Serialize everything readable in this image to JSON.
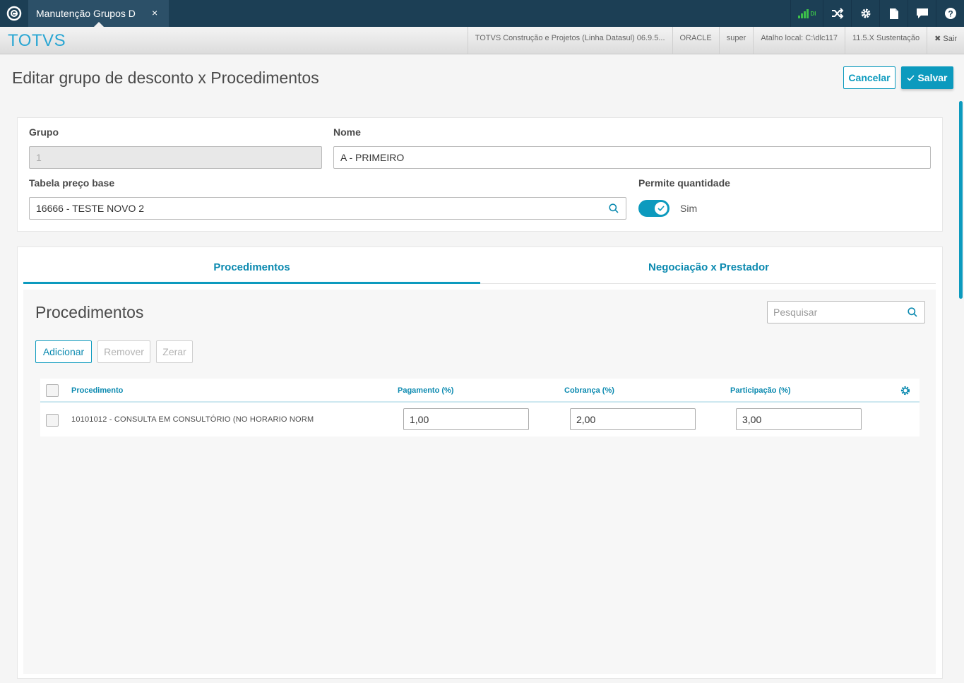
{
  "topbar": {
    "tab_title": "Manutenção Grupos D",
    "tab_close": "×",
    "signal_text": "DI"
  },
  "subbar": {
    "brand": "TOTVS",
    "items": [
      "TOTVS Construção e Projetos (Linha Datasul) 06.9.5...",
      "ORACLE",
      "super",
      "Atalho local: C:\\dlc117",
      "11.5.X Sustentação"
    ],
    "exit_label": "✖ Sair"
  },
  "page": {
    "title": "Editar grupo de desconto x Procedimentos",
    "cancel_label": "Cancelar",
    "save_label": "Salvar"
  },
  "form": {
    "grupo_label": "Grupo",
    "grupo_value": "1",
    "nome_label": "Nome",
    "nome_value": "A - PRIMEIRO",
    "tabela_label": "Tabela preço base",
    "tabela_value": "16666 - TESTE NOVO 2",
    "permite_label": "Permite quantidade",
    "permite_value": "Sim"
  },
  "tabs": [
    {
      "label": "Procedimentos",
      "active": true
    },
    {
      "label": "Negociação x Prestador",
      "active": false
    }
  ],
  "procedimentos": {
    "title": "Procedimentos",
    "search_placeholder": "Pesquisar",
    "add_label": "Adicionar",
    "remove_label": "Remover",
    "reset_label": "Zerar",
    "columns": [
      "Procedimento",
      "Pagamento (%)",
      "Cobrança (%)",
      "Participação (%)"
    ],
    "rows": [
      {
        "procedimento": "10101012 - CONSULTA EM CONSULTÓRIO (NO HORARIO NORM",
        "pagamento": "1,00",
        "cobranca": "2,00",
        "participacao": "3,00"
      }
    ]
  },
  "colors": {
    "topbar": "#1c3f55",
    "accent": "#0c9abe",
    "brand": "#29a6d3"
  }
}
